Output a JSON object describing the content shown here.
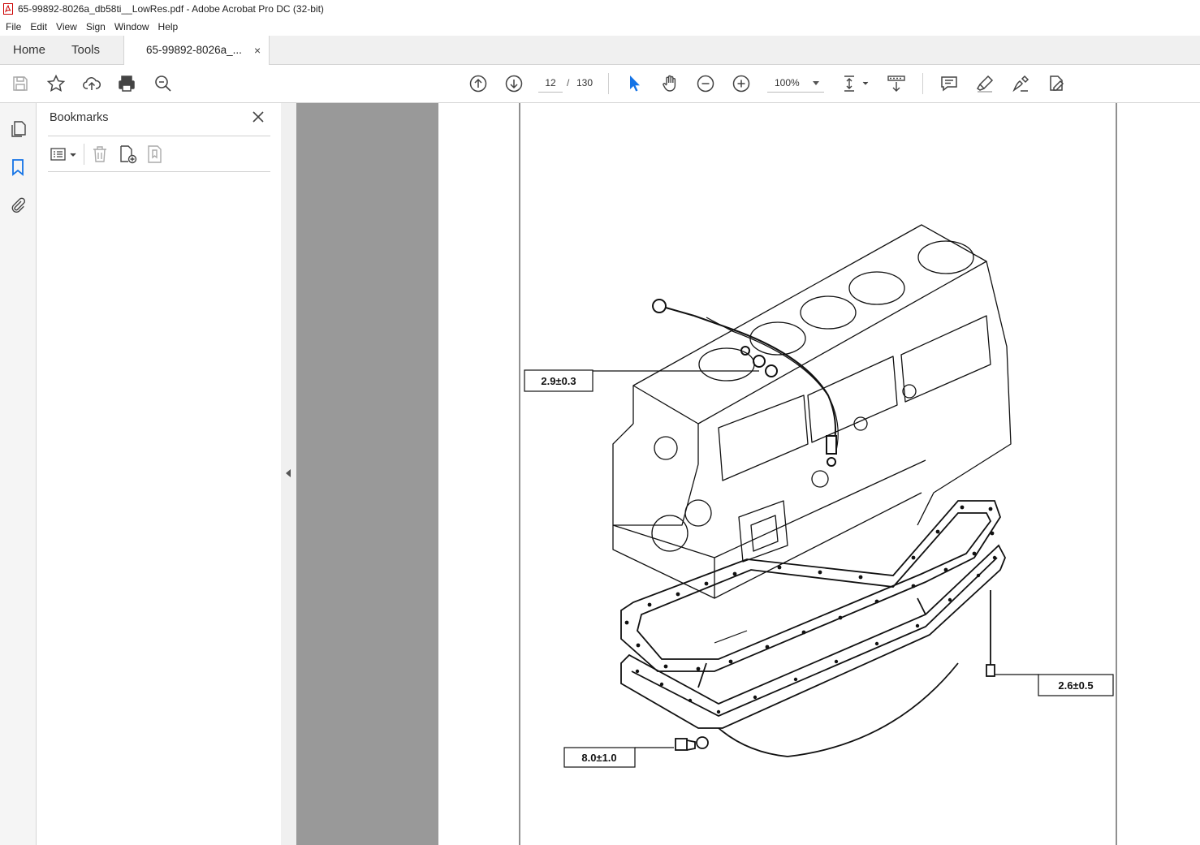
{
  "window": {
    "title": "65-99892-8026a_db58ti__LowRes.pdf - Adobe Acrobat Pro DC (32-bit)"
  },
  "menu": {
    "items": [
      "File",
      "Edit",
      "View",
      "Sign",
      "Window",
      "Help"
    ]
  },
  "tabs": {
    "home": "Home",
    "tools": "Tools",
    "document": "65-99892-8026a_...",
    "close": "×"
  },
  "toolbar": {
    "page_current": "12",
    "page_separator": "/",
    "page_total": "130",
    "zoom": "100%"
  },
  "bookmarks": {
    "title": "Bookmarks"
  },
  "drawing": {
    "labels": {
      "dipstick_torque": "2.9±0.3",
      "drain_plug_torque": "8.0±1.0",
      "pan_bolt_torque": "2.6±0.5"
    }
  },
  "colors": {
    "doc_background": "#999999",
    "selection_accent": "#1473e6"
  },
  "icons": [
    "save-icon",
    "star-icon",
    "upload-icon",
    "print-icon",
    "find-icon",
    "previous-page-icon",
    "next-page-icon",
    "select-arrow-icon",
    "hand-icon",
    "zoom-out-icon",
    "zoom-in-icon",
    "page-fit-icon",
    "scroll-mode-icon",
    "comment-icon",
    "highlight-icon",
    "sign-icon",
    "redact-icon",
    "pages-icon",
    "bookmark-icon",
    "attachment-icon"
  ]
}
